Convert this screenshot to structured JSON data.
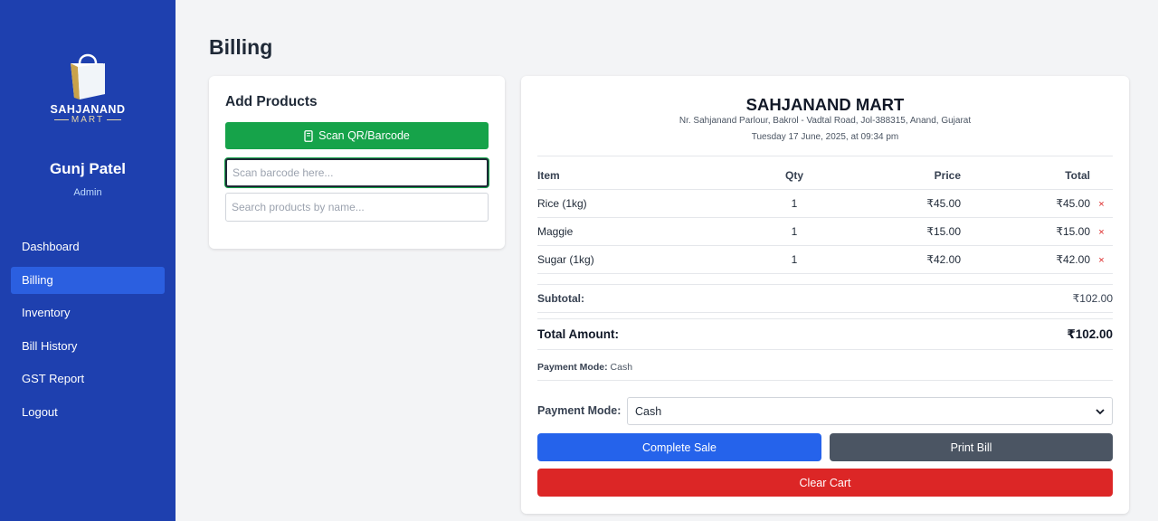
{
  "sidebar": {
    "logo_text": "SAHJANAND",
    "logo_sub": "MART",
    "user_name": "Gunj Patel",
    "user_role": "Admin",
    "nav": [
      {
        "label": "Dashboard",
        "active": false
      },
      {
        "label": "Billing",
        "active": true
      },
      {
        "label": "Inventory",
        "active": false
      },
      {
        "label": "Bill History",
        "active": false
      },
      {
        "label": "GST Report",
        "active": false
      },
      {
        "label": "Logout",
        "active": false
      }
    ]
  },
  "page": {
    "title": "Billing"
  },
  "add_products": {
    "title": "Add Products",
    "scan_button": "Scan QR/Barcode",
    "barcode_placeholder": "Scan barcode here...",
    "search_placeholder": "Search products by name..."
  },
  "bill": {
    "store_name": "SAHJANAND MART",
    "address": "Nr. Sahjanand Parlour, Bakrol - Vadtal Road, Jol-388315, Anand, Gujarat",
    "date": "Tuesday 17 June, 2025, at 09:34 pm",
    "columns": [
      "Item",
      "Qty",
      "Price",
      "Total"
    ],
    "items": [
      {
        "name": "Rice (1kg)",
        "qty": "1",
        "price": "₹45.00",
        "total": "₹45.00"
      },
      {
        "name": "Maggie",
        "qty": "1",
        "price": "₹15.00",
        "total": "₹15.00"
      },
      {
        "name": "Sugar (1kg)",
        "qty": "1",
        "price": "₹42.00",
        "total": "₹42.00"
      }
    ],
    "remove_symbol": "×",
    "subtotal_label": "Subtotal:",
    "subtotal_value": "₹102.00",
    "total_label": "Total Amount:",
    "total_value": "₹102.00",
    "payment_note_label": "Payment Mode:",
    "payment_note_value": "Cash",
    "payment_mode_label": "Payment Mode:",
    "payment_mode_selected": "Cash",
    "complete_button": "Complete Sale",
    "print_button": "Print Bill",
    "clear_button": "Clear Cart"
  },
  "colors": {
    "sidebar_bg": "#1e40af",
    "active_nav": "#2b5fe0",
    "scan_green": "#16a34a",
    "complete_blue": "#2563eb",
    "print_gray": "#4b5563",
    "clear_red": "#dc2626"
  }
}
